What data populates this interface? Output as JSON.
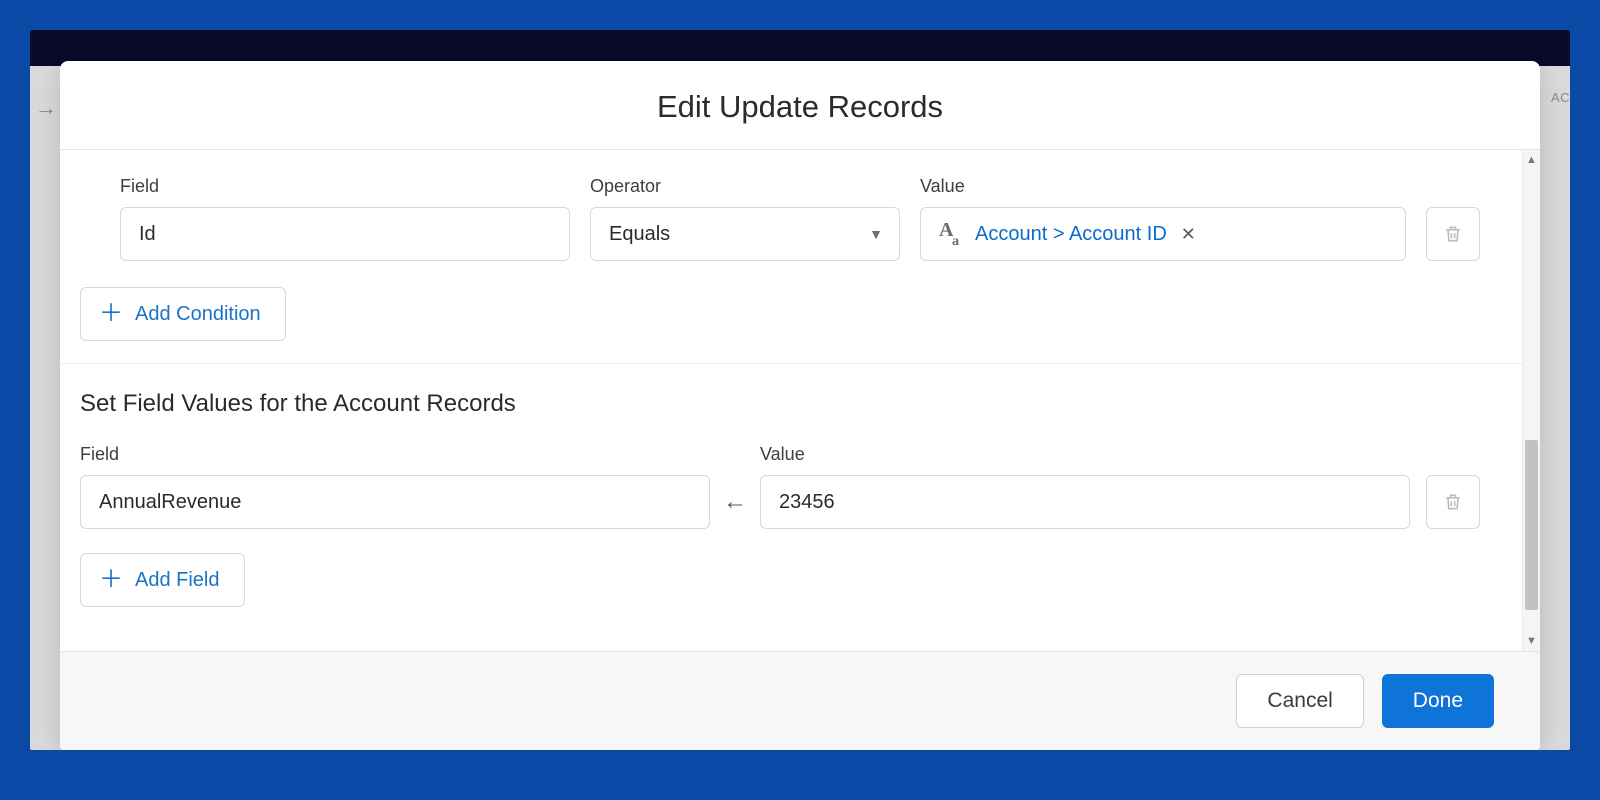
{
  "modal": {
    "title": "Edit Update Records",
    "condition_section": {
      "labels": {
        "field": "Field",
        "operator": "Operator",
        "value": "Value"
      },
      "row": {
        "field": "Id",
        "operator": "Equals",
        "value_pill": "Account > Account ID"
      },
      "add_label": "Add Condition"
    },
    "set_values_section": {
      "heading": "Set Field Values for the Account Records",
      "labels": {
        "field": "Field",
        "value": "Value"
      },
      "row": {
        "field": "AnnualRevenue",
        "value": "23456"
      },
      "add_label": "Add Field"
    },
    "footer": {
      "cancel": "Cancel",
      "done": "Done"
    }
  },
  "backdrop": {
    "right_hint": "AC"
  }
}
